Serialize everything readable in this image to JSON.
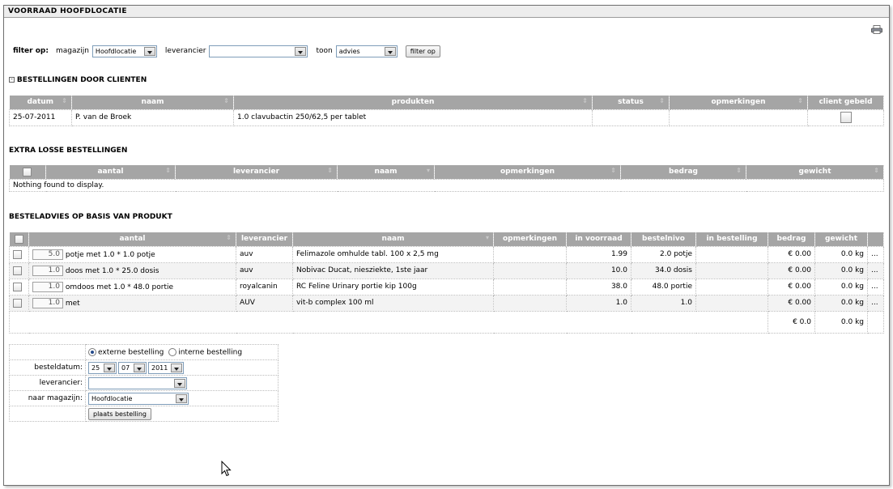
{
  "window": {
    "title": "VOORRAAD HOOFDLOCATIE"
  },
  "icons": {
    "print": "printer-icon",
    "collapse": "minus-box-icon",
    "cursor": "mouse-pointer-icon"
  },
  "filter": {
    "label": "filter op:",
    "magazijn_label": "magazijn",
    "magazijn_value": "Hoofdlocatie",
    "leverancier_label": "leverancier",
    "leverancier_value": "",
    "toon_label": "toon",
    "toon_value": "advies",
    "button": "filter op"
  },
  "client_orders": {
    "title": "BESTELLINGEN DOOR CLIENTEN",
    "columns": [
      "datum",
      "naam",
      "produkten",
      "status",
      "opmerkingen",
      "client gebeld"
    ],
    "rows": [
      {
        "datum": "25-07-2011",
        "naam": "P. van de Broek",
        "produkten": "1.0 clavubactin 250/62,5 per tablet",
        "status": "",
        "opmerkingen": ""
      }
    ]
  },
  "extra_orders": {
    "title": "EXTRA LOSSE BESTELLINGEN",
    "columns": [
      "aantal",
      "leverancier",
      "naam",
      "opmerkingen",
      "bedrag",
      "gewicht"
    ],
    "empty_text": "Nothing found to display."
  },
  "advice": {
    "title": "BESTELADVIES OP BASIS VAN PRODUKT",
    "columns": [
      "aantal",
      "leverancier",
      "naam",
      "opmerkingen",
      "in voorraad",
      "bestelnivo",
      "in bestelling",
      "bedrag",
      "gewicht"
    ],
    "rows": [
      {
        "qty": "5.0",
        "unit": "potje met 1.0 * 1.0 potje",
        "leverancier": "auv",
        "naam": "Felimazole omhulde tabl. 100 x 2,5 mg",
        "opmerkingen": "",
        "voorraad": "1.99",
        "bestelnivo": "2.0 potje",
        "in_bestelling": "",
        "bedrag": "€ 0.00",
        "gewicht": "0.0 kg",
        "more": "..."
      },
      {
        "qty": "1.0",
        "unit": "doos met 1.0 * 25.0 dosis",
        "leverancier": "auv",
        "naam": "Nobivac Ducat, niesziekte, 1ste jaar",
        "opmerkingen": "",
        "voorraad": "10.0",
        "bestelnivo": "34.0 dosis",
        "in_bestelling": "",
        "bedrag": "€ 0.00",
        "gewicht": "0.0 kg",
        "more": "..."
      },
      {
        "qty": "1.0",
        "unit": "omdoos met 1.0 * 48.0 portie",
        "leverancier": "royalcanin",
        "naam": "RC Feline Urinary portie kip 100g",
        "opmerkingen": "",
        "voorraad": "38.0",
        "bestelnivo": "48.0 portie",
        "in_bestelling": "",
        "bedrag": "€ 0.00",
        "gewicht": "0.0 kg",
        "more": "..."
      },
      {
        "qty": "1.0",
        "unit": "met",
        "leverancier": "AUV",
        "naam": "vit-b complex 100 ml",
        "opmerkingen": "",
        "voorraad": "1.0",
        "bestelnivo": "1.0",
        "in_bestelling": "",
        "bedrag": "€ 0.00",
        "gewicht": "0.0 kg",
        "more": "..."
      }
    ],
    "total_bedrag": "€ 0.0",
    "total_gewicht": "0.0 kg"
  },
  "order_form": {
    "radio_external": "externe bestelling",
    "radio_internal": "interne bestelling",
    "selected": "externe",
    "besteldatum_label": "besteldatum:",
    "day": "25",
    "month": "07",
    "year": "2011",
    "leverancier_label": "leverancier:",
    "leverancier_value": "",
    "magazijn_label": "naar magazijn:",
    "magazijn_value": "Hoofdlocatie",
    "submit": "plaats bestelling"
  }
}
